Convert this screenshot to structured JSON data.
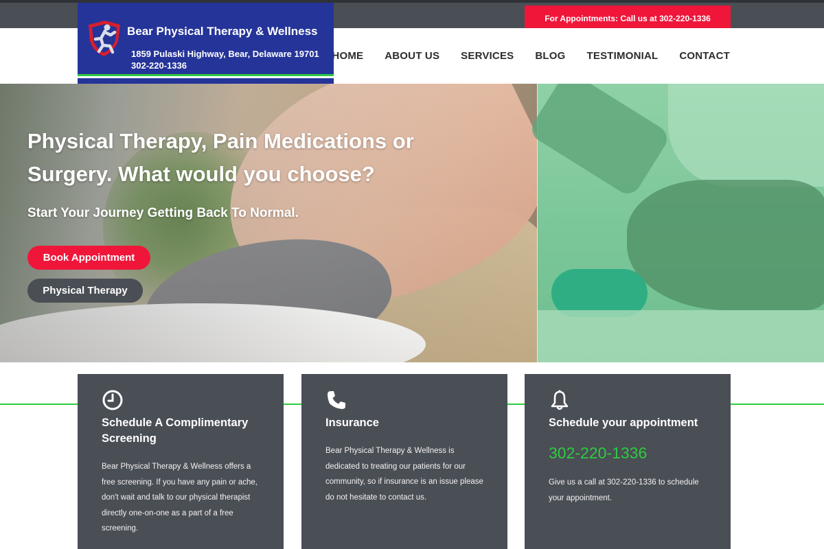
{
  "topbar": {
    "appointment_text": "For Appointments: Call us at 302-220-1336"
  },
  "logo": {
    "title": "Bear Physical Therapy & Wellness",
    "address": "1859 Pulaski Highway, Bear, Delaware 19701",
    "phone": "302-220-1336"
  },
  "nav": {
    "items": [
      {
        "label": "HOME"
      },
      {
        "label": "ABOUT US"
      },
      {
        "label": "SERVICES"
      },
      {
        "label": "BLOG"
      },
      {
        "label": "TESTIMONIAL"
      },
      {
        "label": "CONTACT"
      }
    ]
  },
  "hero": {
    "title": "Physical Therapy, Pain Medications or Surgery. What would you choose?",
    "subtitle": "Start Your Journey Getting Back To Normal.",
    "book_button": "Book Appointment",
    "pt_button": "Physical Therapy"
  },
  "cards": [
    {
      "icon": "clock-icon",
      "title": "Schedule A Complimentary Screening",
      "body": "Bear Physical Therapy & Wellness offers a free screening. If you have any pain or ache, don't wait and talk to our physical therapist directly one-on-one as a part of a free screening."
    },
    {
      "icon": "phone-icon",
      "title": "Insurance",
      "body": "Bear Physical Therapy & Wellness is dedicated to treating our patients for our community, so if insurance is an issue please do not hesitate to contact us."
    },
    {
      "icon": "bell-icon",
      "title": "Schedule your appointment",
      "phone": "302-220-1336",
      "body": "Give us a call at 302-220-1336 to schedule your appointment."
    }
  ],
  "colors": {
    "accent_red": "#f0163a",
    "dark_gray": "#4a4e55",
    "logo_blue": "#253499",
    "accent_green": "#2ecc40"
  }
}
